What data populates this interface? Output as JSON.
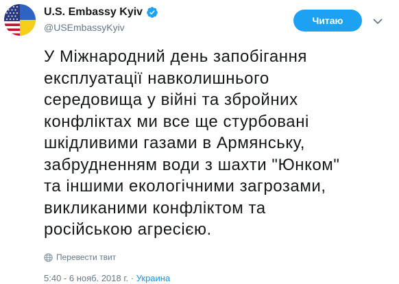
{
  "author": {
    "display_name": "U.S. Embassy Kyiv",
    "handle": "@USEmbassyKyiv",
    "verified": true,
    "avatar": "us-ukraine-flag-avatar"
  },
  "follow_button": {
    "label": "Читаю"
  },
  "tweet": {
    "text": "У Міжнародний день запобігання\nексплуатації навколишнього\nсередовища у війні та збройних\nконфліктах ми все ще стурбовані\nшкідливими газами в Армянську,\nзабрудненням води з шахти \"Юнком\"\nта іншими екологічними загрозами,\nвикликаними конфліктом та\nросійською агресією.",
    "translate_label": "Перевести твит",
    "timestamp": "5:40 - 6 нояб. 2018 г.",
    "location": "Украина"
  },
  "colors": {
    "accent": "#1da1f2",
    "link": "#1b95e0",
    "secondary_text": "#657786",
    "primary_text": "#14171a"
  },
  "icons": {
    "verified": "verified-badge-icon",
    "caret": "chevron-down-icon",
    "translate": "globe-icon"
  }
}
